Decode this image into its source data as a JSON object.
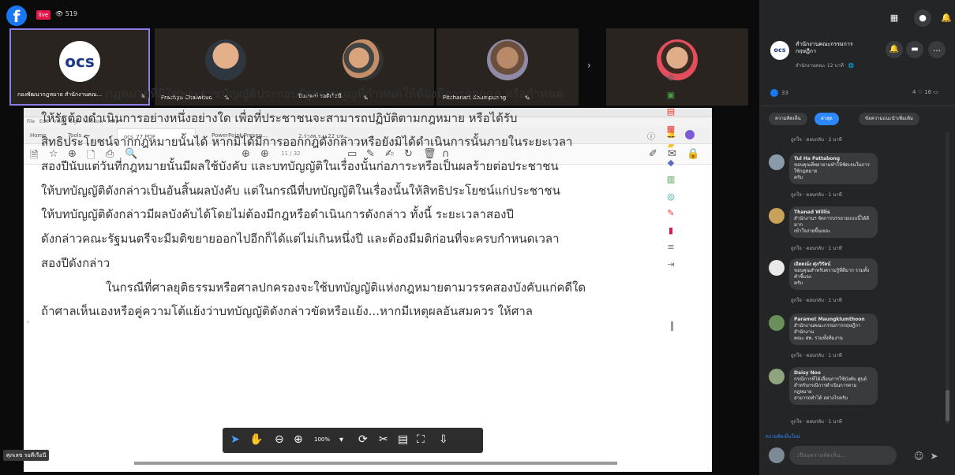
{
  "top": {
    "logo": "f",
    "live": "live",
    "viewers": "👁 519"
  },
  "participants": [
    {
      "name": "กองพัฒนากฎหมาย สำนักงานคณ...",
      "initials": "ocs",
      "mic": "✎"
    },
    {
      "name": "Prachya Chaiwitud",
      "mic": "✎"
    },
    {
      "name": "ปิยะพงษ์ รอดีเรือนี",
      "mic": "✎"
    },
    {
      "name": "Pitchanart Khumpuang",
      "mic": "✎"
    },
    {
      "name": "",
      "mic": ""
    }
  ],
  "viewer": {
    "menu": [
      "File",
      "Edit",
      "View",
      "Sign",
      "Window",
      "Help"
    ],
    "home": "Home",
    "tools": "Tools",
    "tabs": [
      "ocs_77.PDF",
      "PowerPoint Presen...",
      "2.ร่างพ.ร.บ.22 บท..."
    ],
    "page_info": "11 / 32",
    "zoom": "100%",
    "lines": [
      "กฎหมายที่มิใช่พระราชบัญญัติประกอบรัฐธรรมนูญที่กำหนดให้ต้องมีการออกกฎ หรือกำหนด",
      "ให้รัฐต้องดำเนินการอย่างหนึ่งอย่างใด เพื่อที่ประชาชนจะสามารถปฏิบัติตามกฎหมาย หรือได้รับ",
      "สิทธิประโยชน์จากกฎหมายนั้นได้ หากมิได้มีการออกกฎดังกล่าวหรือยังมิได้ดำเนินการนั้นภายในระยะเวลา",
      "สองปีนับแต่วันที่กฎหมายนั้นมีผลใช้บังคับ และบทบัญญัติในเรื่องนั้นก่อภาระหรือเป็นผลร้ายต่อประชาชน",
      "ให้บทบัญญัติดังกล่าวเป็นอันสิ้นผลบังคับ แต่ในกรณีที่บทบัญญัติในเรื่องนั้นให้สิทธิประโยชน์แก่ประชาชน",
      "ให้บทบัญญัติดังกล่าวมีผลบังคับได้โดยไม่ต้องมีกฎหรือดำเนินการดังกล่าว ทั้งนี้ ระยะเวลาสองปี",
      "ดังกล่าวคณะรัฐมนตรีจะมีมติขยายออกไปอีกก็ได้แต่ไม่เกินหนึ่งปี และต้องมีมติก่อนที่จะครบกำหนดเวลา",
      "สองปีดังกล่าว",
      "ในกรณีที่ศาลยุติธรรมหรือศาลปกครองจะใช้บทบัญญัติแห่งกฎหมายตามวรรคสองบังคับแก่คดีใด",
      "ถ้าศาลเห็นเองหรือคู่ความโต้แย้งว่าบทบัญญัติดังกล่าวขัดหรือแย้ง...หากมีเหตุผลอันสมควร ให้ศาล"
    ]
  },
  "self_label": "ศุภเลข รอดีเรือนี",
  "panel": {
    "page_name": "สำนักงานคณะกรรมการกฤษฎีกา",
    "page_sub": "สำนักงานคณะ\n12 นาที · 🌐",
    "reactions_count": "33",
    "reactions_right": "4 ♡  16 ▭",
    "chips": [
      "ความคิดเห็น",
      "ล่าสุด",
      "ข้อความแนะนำเพิ่มเติม"
    ],
    "comments": [
      {
        "who": "Tul Ha Pattabong",
        "text": "ขอบคุณที่พยายามทำให้ชัดเจนในการใช้กฎหมาย\nครับ",
        "meta": "ถูกใจ · ตอบกลับ · 1 นาที"
      },
      {
        "who": "Thanad Willis",
        "text": "สำนักงานฯ จัดการบรรยายแบบนี้ได้ดีมาก\nเข้าใจง่ายขึ้นเยอะ",
        "meta": "ถูกใจ · ตอบกลับ · 1 นาที"
      },
      {
        "who": "เอิดดณ์ง ศุภวิรัตน์",
        "text": "ขอบคุณสำหรับความรู้ที่ดีมาก รวมทั้งคำชี้แจง\nครับ",
        "meta": "ถูกใจ · ตอบกลับ · 1 นาที"
      },
      {
        "who": "Paramet Maungklumthoon",
        "text": "สำนักงานคณะกรรมการกฤษฎีกา สำนักงาน\nคณะ สพ. รวมทั้งทีมงาน",
        "meta": "ถูกใจ · ตอบกลับ · 1 นาที"
      },
      {
        "who": "Daisy Noo",
        "text": "กรณีการที่ได้เลื่อนการใช้บังคับ ศูนย์\nสำหรับกรณีการดำเนินการตามกฎหมาย\nสามารถทำได้ อย่างไรครับ",
        "meta": "ถูกใจ · ตอบกลับ · 1 นาที"
      }
    ],
    "top_meta": "ถูกใจ · ตอบกลับ · 2 นาที",
    "new_comments": "ความคิดเห็นใหม่",
    "compose_placeholder": "เขียนความคิดเห็น..."
  }
}
